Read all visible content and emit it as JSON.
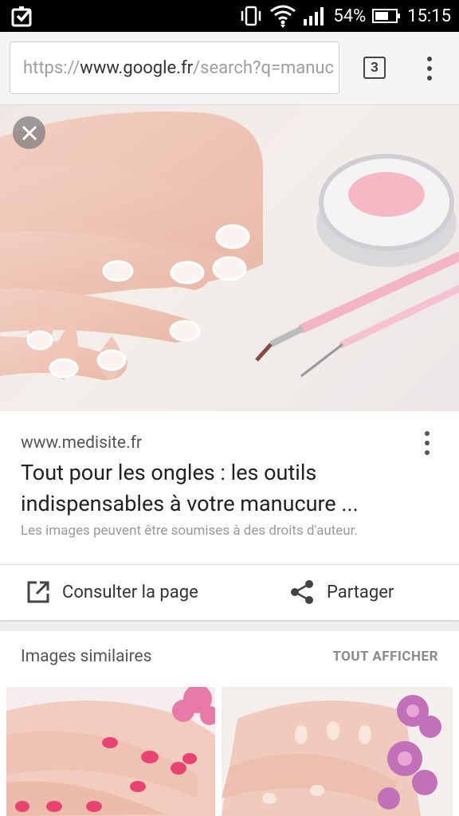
{
  "status_bar": {
    "battery": "54%",
    "time": "15:15",
    "icons": [
      "notification-check-icon",
      "vibrate-icon",
      "wifi-icon",
      "signal-icon",
      "battery-icon"
    ]
  },
  "browser": {
    "url_scheme": "https://",
    "url_domain": "www.google.fr",
    "url_path": "/search?q=manuc",
    "tab_count": "3"
  },
  "result": {
    "source": "www.medisite.fr",
    "title": "Tout pour les ongles : les outils indispensables à votre manucure ...",
    "copyright_notice": "Les images peuvent être soumises à des droits d'auteur.",
    "visit_label": "Consulter la page",
    "share_label": "Partager"
  },
  "similar": {
    "label": "Images similaires",
    "show_all": "TOUT AFFICHER"
  },
  "colors": {
    "status_bg": "#000000",
    "nail_polish_pink": "#e8446f",
    "jar_pink": "#f5b8c4"
  }
}
